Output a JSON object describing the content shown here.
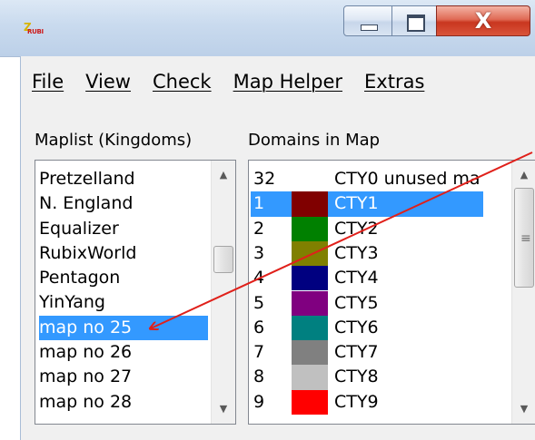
{
  "window": {
    "title": "",
    "controls": {
      "minimize": "minimize",
      "maximize": "maximize",
      "close": "X"
    },
    "icon_text": {
      "top": "Z",
      "bottom": "RUBI"
    }
  },
  "menu": [
    "File",
    "View",
    "Check",
    "Map Helper",
    "Extras"
  ],
  "maplist": {
    "label": "Maplist (Kingdoms)",
    "items": [
      "Pretzelland",
      "N. England",
      "Equalizer",
      "RubixWorld",
      "Pentagon",
      "YinYang",
      "map no 25",
      "map no 26",
      "map no 27",
      "map no 28"
    ],
    "selected": "map no 25"
  },
  "domains": {
    "label": "Domains in Map",
    "rows": [
      {
        "num": "32",
        "name": "CTY0 unused ma",
        "color": ""
      },
      {
        "num": "1",
        "name": "CTY1",
        "color": "#800000"
      },
      {
        "num": "2",
        "name": "CTY2",
        "color": "#008000"
      },
      {
        "num": "3",
        "name": "CTY3",
        "color": "#808000"
      },
      {
        "num": "4",
        "name": "CTY4",
        "color": "#000080"
      },
      {
        "num": "5",
        "name": "CTY5",
        "color": "#800080"
      },
      {
        "num": "6",
        "name": "CTY6",
        "color": "#008080"
      },
      {
        "num": "7",
        "name": "CTY7",
        "color": "#808080"
      },
      {
        "num": "8",
        "name": "CTY8",
        "color": "#c0c0c0"
      },
      {
        "num": "9",
        "name": "CTY9",
        "color": "#ff0000"
      }
    ],
    "selected": "1"
  },
  "colors": {
    "selection": "#3399ff",
    "annotation_arrow": "#e0201a"
  }
}
